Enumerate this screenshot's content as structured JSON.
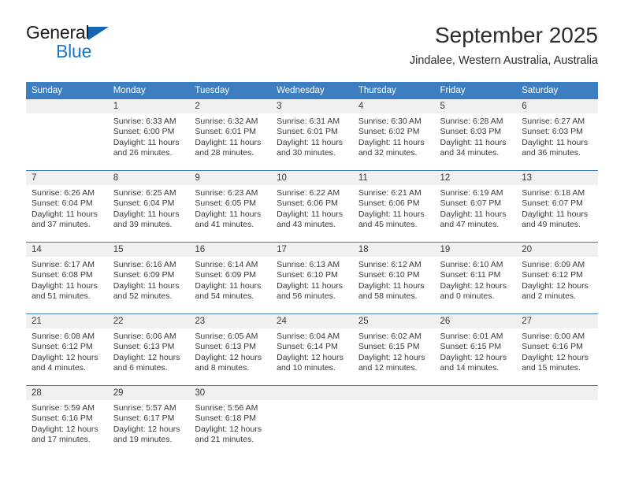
{
  "brand": {
    "name_part1": "General",
    "name_part2": "Blue",
    "flag_icon": "triangle-flag-icon",
    "accent_color": "#1b74c4"
  },
  "header": {
    "month_title": "September 2025",
    "location": "Jindalee, Western Australia, Australia"
  },
  "calendar": {
    "header_bg": "#3c7ebf",
    "daynum_bg": "#f0f0f0",
    "weekday_headers": [
      "Sunday",
      "Monday",
      "Tuesday",
      "Wednesday",
      "Thursday",
      "Friday",
      "Saturday"
    ],
    "weeks": [
      [
        {
          "day": "",
          "blank": true,
          "sunrise": "",
          "sunset": "",
          "daylight_line1": "",
          "daylight_line2": ""
        },
        {
          "day": "1",
          "sunrise": "Sunrise: 6:33 AM",
          "sunset": "Sunset: 6:00 PM",
          "daylight_line1": "Daylight: 11 hours",
          "daylight_line2": "and 26 minutes."
        },
        {
          "day": "2",
          "sunrise": "Sunrise: 6:32 AM",
          "sunset": "Sunset: 6:01 PM",
          "daylight_line1": "Daylight: 11 hours",
          "daylight_line2": "and 28 minutes."
        },
        {
          "day": "3",
          "sunrise": "Sunrise: 6:31 AM",
          "sunset": "Sunset: 6:01 PM",
          "daylight_line1": "Daylight: 11 hours",
          "daylight_line2": "and 30 minutes."
        },
        {
          "day": "4",
          "sunrise": "Sunrise: 6:30 AM",
          "sunset": "Sunset: 6:02 PM",
          "daylight_line1": "Daylight: 11 hours",
          "daylight_line2": "and 32 minutes."
        },
        {
          "day": "5",
          "sunrise": "Sunrise: 6:28 AM",
          "sunset": "Sunset: 6:03 PM",
          "daylight_line1": "Daylight: 11 hours",
          "daylight_line2": "and 34 minutes."
        },
        {
          "day": "6",
          "sunrise": "Sunrise: 6:27 AM",
          "sunset": "Sunset: 6:03 PM",
          "daylight_line1": "Daylight: 11 hours",
          "daylight_line2": "and 36 minutes."
        }
      ],
      [
        {
          "day": "7",
          "sunrise": "Sunrise: 6:26 AM",
          "sunset": "Sunset: 6:04 PM",
          "daylight_line1": "Daylight: 11 hours",
          "daylight_line2": "and 37 minutes."
        },
        {
          "day": "8",
          "sunrise": "Sunrise: 6:25 AM",
          "sunset": "Sunset: 6:04 PM",
          "daylight_line1": "Daylight: 11 hours",
          "daylight_line2": "and 39 minutes."
        },
        {
          "day": "9",
          "sunrise": "Sunrise: 6:23 AM",
          "sunset": "Sunset: 6:05 PM",
          "daylight_line1": "Daylight: 11 hours",
          "daylight_line2": "and 41 minutes."
        },
        {
          "day": "10",
          "sunrise": "Sunrise: 6:22 AM",
          "sunset": "Sunset: 6:06 PM",
          "daylight_line1": "Daylight: 11 hours",
          "daylight_line2": "and 43 minutes."
        },
        {
          "day": "11",
          "sunrise": "Sunrise: 6:21 AM",
          "sunset": "Sunset: 6:06 PM",
          "daylight_line1": "Daylight: 11 hours",
          "daylight_line2": "and 45 minutes."
        },
        {
          "day": "12",
          "sunrise": "Sunrise: 6:19 AM",
          "sunset": "Sunset: 6:07 PM",
          "daylight_line1": "Daylight: 11 hours",
          "daylight_line2": "and 47 minutes."
        },
        {
          "day": "13",
          "sunrise": "Sunrise: 6:18 AM",
          "sunset": "Sunset: 6:07 PM",
          "daylight_line1": "Daylight: 11 hours",
          "daylight_line2": "and 49 minutes."
        }
      ],
      [
        {
          "day": "14",
          "sunrise": "Sunrise: 6:17 AM",
          "sunset": "Sunset: 6:08 PM",
          "daylight_line1": "Daylight: 11 hours",
          "daylight_line2": "and 51 minutes."
        },
        {
          "day": "15",
          "sunrise": "Sunrise: 6:16 AM",
          "sunset": "Sunset: 6:09 PM",
          "daylight_line1": "Daylight: 11 hours",
          "daylight_line2": "and 52 minutes."
        },
        {
          "day": "16",
          "sunrise": "Sunrise: 6:14 AM",
          "sunset": "Sunset: 6:09 PM",
          "daylight_line1": "Daylight: 11 hours",
          "daylight_line2": "and 54 minutes."
        },
        {
          "day": "17",
          "sunrise": "Sunrise: 6:13 AM",
          "sunset": "Sunset: 6:10 PM",
          "daylight_line1": "Daylight: 11 hours",
          "daylight_line2": "and 56 minutes."
        },
        {
          "day": "18",
          "sunrise": "Sunrise: 6:12 AM",
          "sunset": "Sunset: 6:10 PM",
          "daylight_line1": "Daylight: 11 hours",
          "daylight_line2": "and 58 minutes."
        },
        {
          "day": "19",
          "sunrise": "Sunrise: 6:10 AM",
          "sunset": "Sunset: 6:11 PM",
          "daylight_line1": "Daylight: 12 hours",
          "daylight_line2": "and 0 minutes."
        },
        {
          "day": "20",
          "sunrise": "Sunrise: 6:09 AM",
          "sunset": "Sunset: 6:12 PM",
          "daylight_line1": "Daylight: 12 hours",
          "daylight_line2": "and 2 minutes."
        }
      ],
      [
        {
          "day": "21",
          "sunrise": "Sunrise: 6:08 AM",
          "sunset": "Sunset: 6:12 PM",
          "daylight_line1": "Daylight: 12 hours",
          "daylight_line2": "and 4 minutes."
        },
        {
          "day": "22",
          "sunrise": "Sunrise: 6:06 AM",
          "sunset": "Sunset: 6:13 PM",
          "daylight_line1": "Daylight: 12 hours",
          "daylight_line2": "and 6 minutes."
        },
        {
          "day": "23",
          "sunrise": "Sunrise: 6:05 AM",
          "sunset": "Sunset: 6:13 PM",
          "daylight_line1": "Daylight: 12 hours",
          "daylight_line2": "and 8 minutes."
        },
        {
          "day": "24",
          "sunrise": "Sunrise: 6:04 AM",
          "sunset": "Sunset: 6:14 PM",
          "daylight_line1": "Daylight: 12 hours",
          "daylight_line2": "and 10 minutes."
        },
        {
          "day": "25",
          "sunrise": "Sunrise: 6:02 AM",
          "sunset": "Sunset: 6:15 PM",
          "daylight_line1": "Daylight: 12 hours",
          "daylight_line2": "and 12 minutes."
        },
        {
          "day": "26",
          "sunrise": "Sunrise: 6:01 AM",
          "sunset": "Sunset: 6:15 PM",
          "daylight_line1": "Daylight: 12 hours",
          "daylight_line2": "and 14 minutes."
        },
        {
          "day": "27",
          "sunrise": "Sunrise: 6:00 AM",
          "sunset": "Sunset: 6:16 PM",
          "daylight_line1": "Daylight: 12 hours",
          "daylight_line2": "and 15 minutes."
        }
      ],
      [
        {
          "day": "28",
          "sunrise": "Sunrise: 5:59 AM",
          "sunset": "Sunset: 6:16 PM",
          "daylight_line1": "Daylight: 12 hours",
          "daylight_line2": "and 17 minutes."
        },
        {
          "day": "29",
          "sunrise": "Sunrise: 5:57 AM",
          "sunset": "Sunset: 6:17 PM",
          "daylight_line1": "Daylight: 12 hours",
          "daylight_line2": "and 19 minutes."
        },
        {
          "day": "30",
          "sunrise": "Sunrise: 5:56 AM",
          "sunset": "Sunset: 6:18 PM",
          "daylight_line1": "Daylight: 12 hours",
          "daylight_line2": "and 21 minutes."
        },
        {
          "day": "",
          "blank": true,
          "sunrise": "",
          "sunset": "",
          "daylight_line1": "",
          "daylight_line2": ""
        },
        {
          "day": "",
          "blank": true,
          "sunrise": "",
          "sunset": "",
          "daylight_line1": "",
          "daylight_line2": ""
        },
        {
          "day": "",
          "blank": true,
          "sunrise": "",
          "sunset": "",
          "daylight_line1": "",
          "daylight_line2": ""
        },
        {
          "day": "",
          "blank": true,
          "sunrise": "",
          "sunset": "",
          "daylight_line1": "",
          "daylight_line2": ""
        }
      ]
    ]
  }
}
